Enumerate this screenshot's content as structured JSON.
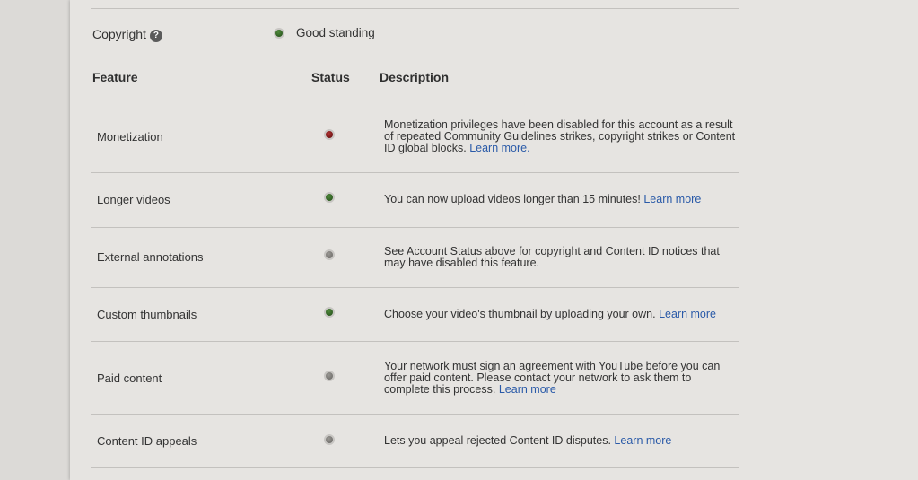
{
  "account": {
    "copyright_label": "Copyright",
    "copyright_status": "Good standing",
    "help_icon_text": "?"
  },
  "table": {
    "headers": {
      "feature": "Feature",
      "status": "Status",
      "description": "Description"
    },
    "rows": [
      {
        "feature": "Monetization",
        "status": "red",
        "description": "Monetization privileges have been disabled for this account as a result of repeated Community Guidelines strikes, copyright strikes or Content ID global blocks.",
        "link": "Learn more."
      },
      {
        "feature": "Longer videos",
        "status": "green",
        "description": "You can now upload videos longer than 15 minutes!",
        "link": "Learn more"
      },
      {
        "feature": "External annotations",
        "status": "gray",
        "description": "See Account Status above for copyright and Content ID notices that may have disabled this feature.",
        "link": ""
      },
      {
        "feature": "Custom thumbnails",
        "status": "green",
        "description": "Choose your video's thumbnail by uploading your own.",
        "link": "Learn more"
      },
      {
        "feature": "Paid content",
        "status": "gray",
        "description": "Your network must sign an agreement with YouTube before you can offer paid content. Please contact your network to ask them to complete this process.",
        "link": "Learn more"
      },
      {
        "feature": "Content ID appeals",
        "status": "gray",
        "description": "Lets you appeal rejected Content ID disputes.",
        "link": "Learn more"
      }
    ]
  },
  "colors": {
    "link": "#2a5aa8",
    "green": "#3d7a2a",
    "red": "#8f1f1f",
    "gray": "#8a8885"
  }
}
